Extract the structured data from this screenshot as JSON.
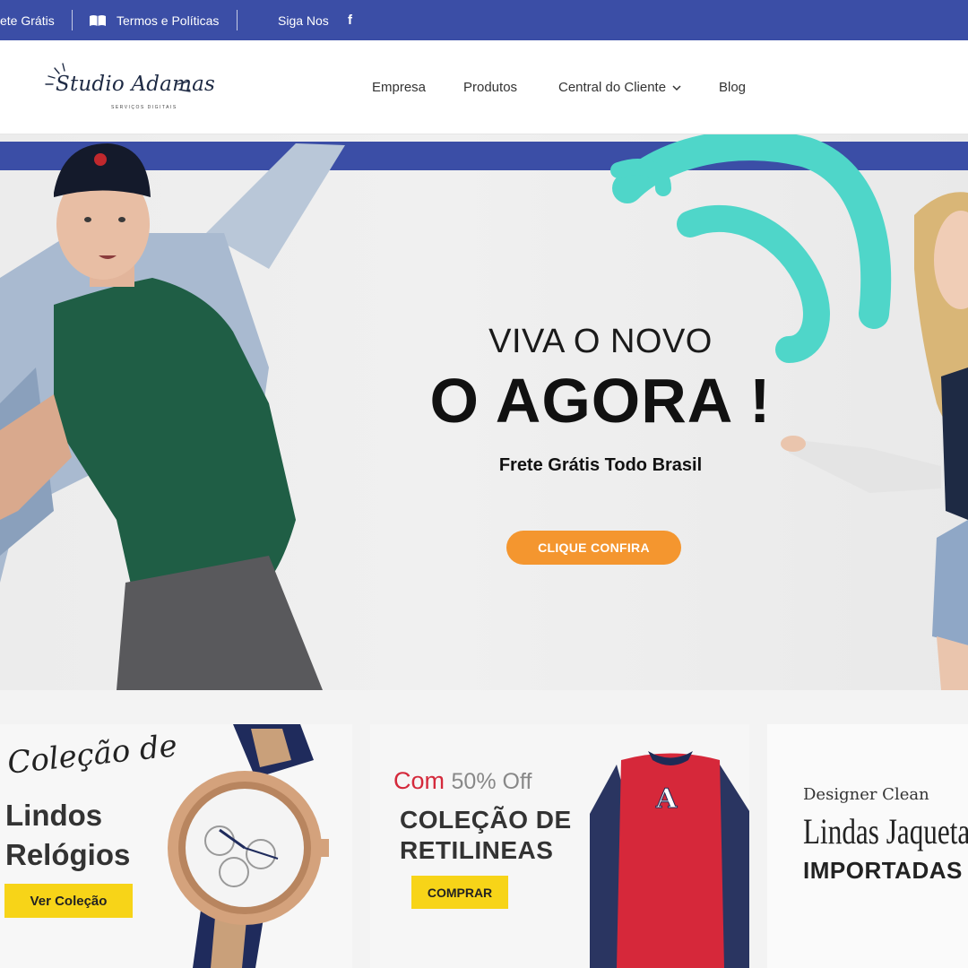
{
  "topbar": {
    "shipping": "ete Grátis",
    "terms": "Termos e Políticas",
    "follow": "Siga Nos",
    "facebook_glyph": "f"
  },
  "logo": {
    "name": "Studio Adamas",
    "tagline": "SERVIÇOS DIGITAIS"
  },
  "nav": {
    "items": [
      "Empresa",
      "Produtos",
      "Central do Cliente",
      "Blog"
    ],
    "dropdown_glyph": "⌄"
  },
  "hero": {
    "subtitle": "VIVA O NOVO",
    "title": "O AGORA !",
    "shipping": "Frete Grátis Todo Brasil",
    "button": "CLIQUE CONFIRA"
  },
  "cards": {
    "watches": {
      "script": "Coleção de",
      "line1": "Lindos",
      "line2": "Relógios",
      "button": "Ver Coleção"
    },
    "shirts": {
      "prefix": "Com",
      "discount": "50% Off",
      "line1": "COLEÇÃO DE",
      "line2": "RETILINEAS",
      "button": "COMPRAR",
      "shirt_letter": "A"
    },
    "jackets": {
      "line1": "Designer Clean",
      "line2": "Lindas Jaquetas",
      "line3": "IMPORTADAS"
    }
  },
  "colors": {
    "brand_blue": "#3b4ea6",
    "accent_orange": "#f4962f",
    "accent_yellow": "#f7d418",
    "teal_brush": "#4fd6c9",
    "sale_red": "#d4293b"
  }
}
